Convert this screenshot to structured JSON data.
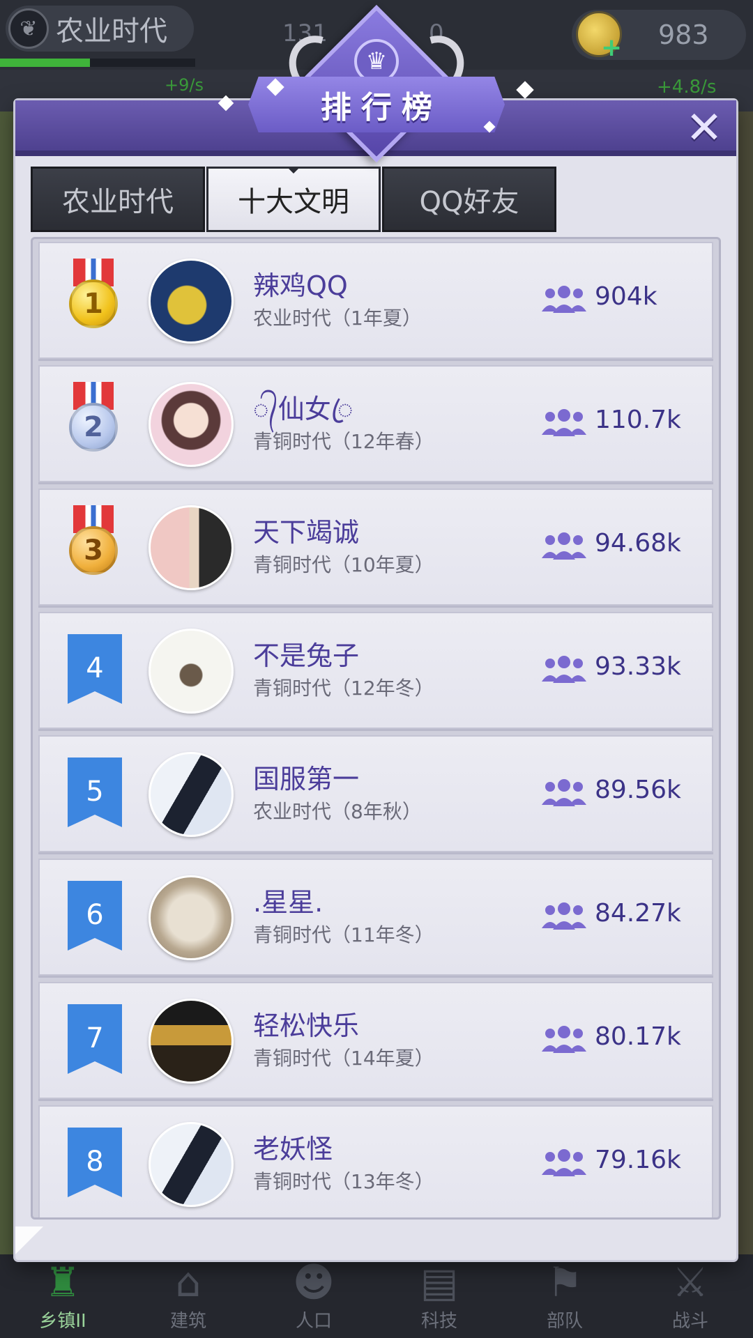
{
  "status_bar": {
    "era_title": "农业时代",
    "population_partial": "131",
    "population_tail": "0",
    "coins": "983",
    "rate_left": "+9/s",
    "rate_right": "+4.8/s"
  },
  "modal": {
    "title": "排行榜",
    "close_icon": "close-icon",
    "tabs": [
      {
        "label": "农业时代",
        "active": false
      },
      {
        "label": "十大文明",
        "active": true
      },
      {
        "label": "QQ好友",
        "active": false
      }
    ]
  },
  "leaderboard": [
    {
      "rank": "1",
      "badge": "gold-medal",
      "name": "辣鸡QQ",
      "era": "农业时代（1年夏）",
      "population": "904k",
      "avatar_colors": [
        "#1e3a6e",
        "#e0c23a"
      ]
    },
    {
      "rank": "2",
      "badge": "silver-medal",
      "name": "᭄仙女ꦿ",
      "era": "青铜时代（12年春）",
      "population": "110.7k",
      "avatar_colors": [
        "#f2d3de",
        "#5b3a3a"
      ]
    },
    {
      "rank": "3",
      "badge": "bronze-medal",
      "name": "天下竭诚",
      "era": "青铜时代（10年夏）",
      "population": "94.68k",
      "avatar_colors": [
        "#f0c8c4",
        "#2a2a2a"
      ]
    },
    {
      "rank": "4",
      "badge": "flag",
      "name": "不是兔子",
      "era": "青铜时代（12年冬）",
      "population": "93.33k",
      "avatar_colors": [
        "#f5f5f0",
        "#6a5a4a"
      ]
    },
    {
      "rank": "5",
      "badge": "flag",
      "name": "国服第一",
      "era": "农业时代（8年秋）",
      "population": "89.56k",
      "avatar_colors": [
        "#eef2f8",
        "#1c2230"
      ]
    },
    {
      "rank": "6",
      "badge": "flag",
      "name": ".星星.",
      "era": "青铜时代（11年冬）",
      "population": "84.27k",
      "avatar_colors": [
        "#d8cfc0",
        "#8a7a66"
      ]
    },
    {
      "rank": "7",
      "badge": "flag",
      "name": "轻松快乐",
      "era": "青铜时代（14年夏）",
      "population": "80.17k",
      "avatar_colors": [
        "#1a1a1a",
        "#c89a3a"
      ]
    },
    {
      "rank": "8",
      "badge": "flag",
      "name": "老妖怪",
      "era": "青铜时代（13年冬）",
      "population": "79.16k",
      "avatar_colors": [
        "#eef2f8",
        "#1c2230"
      ]
    }
  ],
  "bottom_nav": [
    {
      "label": "乡镇II",
      "icon": "castle-icon",
      "active": true
    },
    {
      "label": "建筑",
      "icon": "house-icon",
      "active": false
    },
    {
      "label": "人口",
      "icon": "person-icon",
      "active": false
    },
    {
      "label": "科技",
      "icon": "book-icon",
      "active": false
    },
    {
      "label": "部队",
      "icon": "banner-icon",
      "active": false
    },
    {
      "label": "战斗",
      "icon": "swords-icon",
      "active": false
    }
  ],
  "colors": {
    "header_purple": "#5a4aa2",
    "name_purple": "#4b3d9a",
    "rank_flag_blue": "#3d86e0",
    "tab_dark": "#2b2d34"
  }
}
